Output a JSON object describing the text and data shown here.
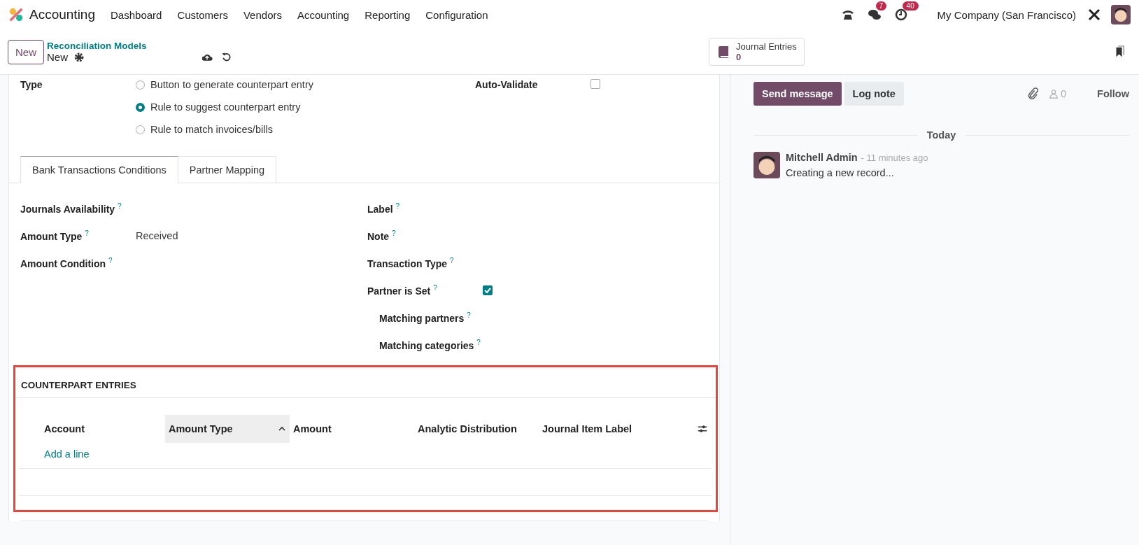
{
  "navbar": {
    "app_name": "Accounting",
    "menu": [
      "Dashboard",
      "Customers",
      "Vendors",
      "Accounting",
      "Reporting",
      "Configuration"
    ],
    "message_count": "7",
    "activity_count": "40",
    "company": "My Company (San Francisco)"
  },
  "control_panel": {
    "new_button": "New",
    "breadcrumb": "Reconciliation Models",
    "record": "New",
    "smart_button": {
      "label": "Journal Entries",
      "count": "0"
    }
  },
  "form": {
    "type_label": "Type",
    "type_options": [
      {
        "label": "Button to generate counterpart entry",
        "selected": false
      },
      {
        "label": "Rule to suggest counterpart entry",
        "selected": true
      },
      {
        "label": "Rule to match invoices/bills",
        "selected": false
      }
    ],
    "auto_validate": {
      "label": "Auto-Validate",
      "checked": false
    },
    "tabs": [
      {
        "label": "Bank Transactions Conditions",
        "selected": true
      },
      {
        "label": "Partner Mapping",
        "selected": false
      }
    ],
    "fields_left": [
      {
        "label": "Journals Availability",
        "help": "?"
      },
      {
        "label": "Amount Type",
        "help": "?",
        "value": "Received"
      },
      {
        "label": "Amount Condition",
        "help": "?"
      }
    ],
    "fields_right": [
      {
        "label": "Label",
        "help": "?",
        "kind": "text"
      },
      {
        "label": "Note",
        "help": "?",
        "kind": "text"
      },
      {
        "label": "Transaction Type",
        "help": "?",
        "kind": "text"
      },
      {
        "label": "Partner is Set",
        "help": "?",
        "kind": "checkbox",
        "checked": true,
        "children": [
          {
            "label": "Matching partners",
            "help": "?"
          },
          {
            "label": "Matching categories",
            "help": "?"
          }
        ]
      }
    ],
    "counterpart": {
      "title": "COUNTERPART ENTRIES",
      "columns": [
        {
          "label": "Account",
          "sorted": false
        },
        {
          "label": "Amount Type",
          "sorted": true
        },
        {
          "label": "Amount",
          "sorted": false
        },
        {
          "label": "Analytic Distribution",
          "sorted": false
        },
        {
          "label": "Journal Item Label",
          "sorted": false
        }
      ],
      "add_line": "Add a line"
    }
  },
  "chatter": {
    "send_message": "Send message",
    "log_note": "Log note",
    "followers": "0",
    "follow": "Follow",
    "date_separator": "Today",
    "messages": [
      {
        "author": "Mitchell Admin",
        "time": "- 11 minutes ago",
        "body": "Creating a new record..."
      }
    ]
  }
}
